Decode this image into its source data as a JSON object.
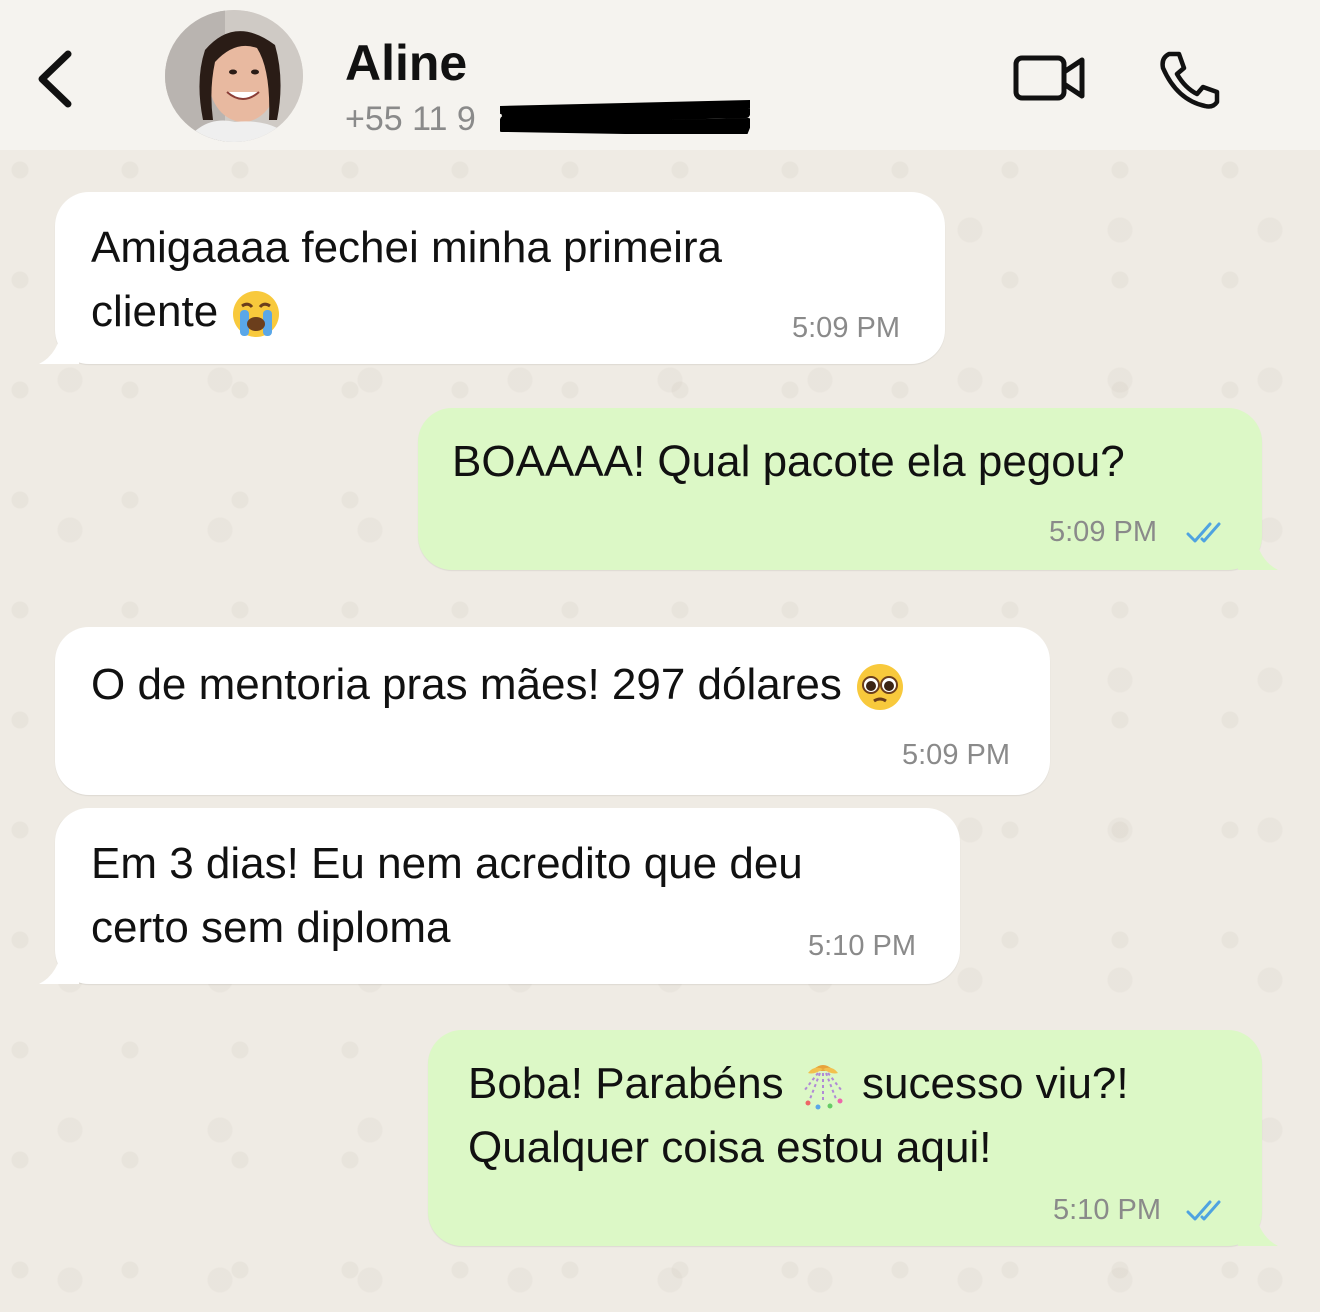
{
  "header": {
    "contact_name": "Aline",
    "phone_visible": "+55 11 9",
    "back_icon": "chevron-left-icon",
    "video_icon": "video-camera-icon",
    "call_icon": "phone-icon"
  },
  "messages": [
    {
      "direction": "in",
      "text": "Amigaaaa fechei minha primeira\ncliente",
      "emoji": "loudly-crying-face",
      "time": "5:09 PM"
    },
    {
      "direction": "out",
      "text": "BOAAAA! Qual pacote ela pegou?",
      "time": "5:09 PM",
      "status": "read"
    },
    {
      "direction": "in",
      "text": "O de mentoria pras mães! 297 dólares",
      "emoji": "pleading-face",
      "time": "5:09 PM"
    },
    {
      "direction": "in",
      "text": "Em 3 dias! Eu nem acredito que deu\ncerto sem diploma",
      "time": "5:10 PM"
    },
    {
      "direction": "out",
      "text_line1_a": "Boba! Parabéns",
      "emoji": "confetti-ball",
      "text_line1_b": "sucesso viu?!",
      "text_line2": "Qualquer coisa estou aqui!",
      "time": "5:10 PM",
      "status": "read"
    }
  ],
  "colors": {
    "incoming_bubble": "#ffffff",
    "outgoing_bubble": "#dcf8c6",
    "read_ticks": "#4fa3e0",
    "background": "#efebe4"
  }
}
